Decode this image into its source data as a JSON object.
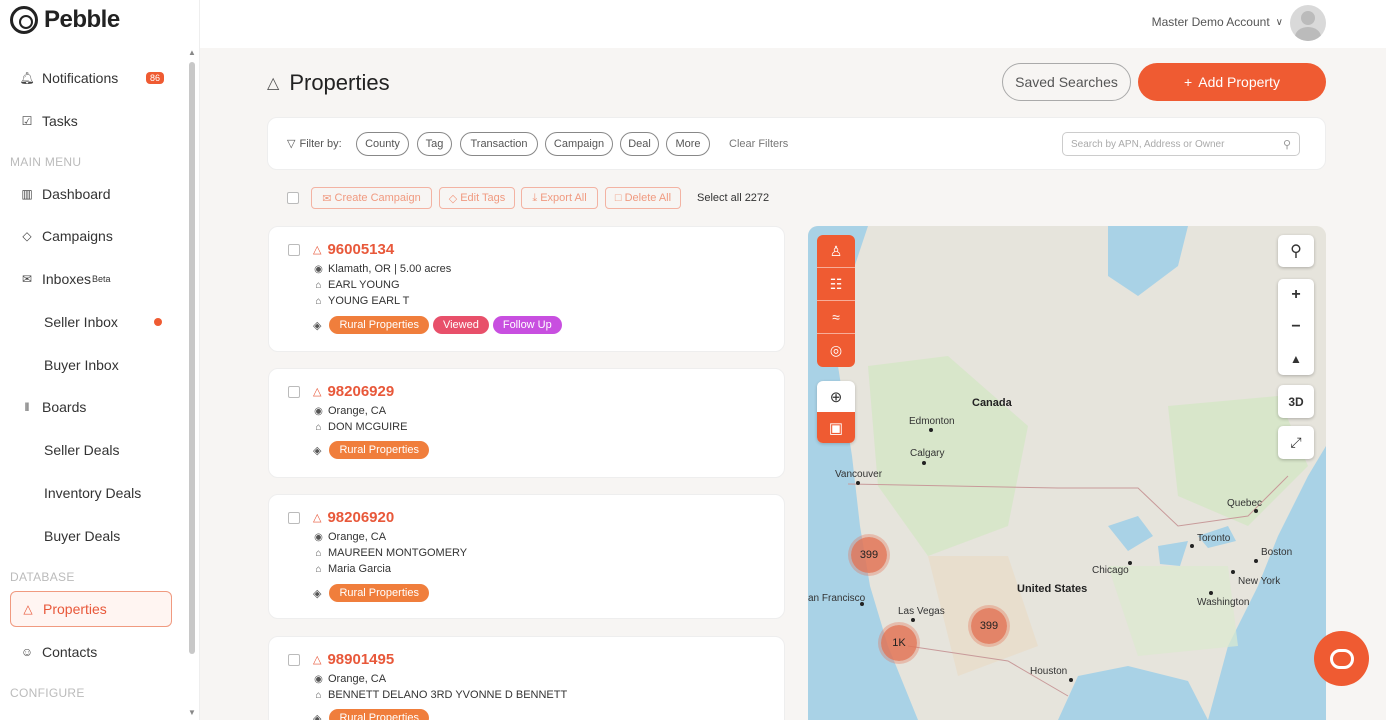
{
  "brand": {
    "name": "Pebble"
  },
  "sidebar": {
    "notifications": {
      "label": "Notifications",
      "count": "86"
    },
    "tasks": "Tasks",
    "main_menu_label": "MAIN MENU",
    "dashboard": "Dashboard",
    "campaigns": "Campaigns",
    "inboxes": {
      "label": "Inboxes",
      "badge": "Beta"
    },
    "seller_inbox": "Seller Inbox",
    "buyer_inbox": "Buyer Inbox",
    "boards": "Boards",
    "seller_deals": "Seller Deals",
    "inventory_deals": "Inventory Deals",
    "buyer_deals": "Buyer Deals",
    "database_label": "DATABASE",
    "properties": "Properties",
    "contacts": "Contacts",
    "configure_label": "CONFIGURE"
  },
  "topbar": {
    "account": "Master Demo Account"
  },
  "header": {
    "title": "Properties",
    "saved_searches": "Saved Searches",
    "add_property": "Add Property"
  },
  "filters": {
    "label": "Filter by:",
    "chips": [
      "County",
      "Tag",
      "Transaction",
      "Campaign",
      "Deal",
      "More"
    ],
    "clear": "Clear Filters",
    "search_placeholder": "Search by APN, Address or Owner"
  },
  "bulk": {
    "create_campaign": "Create Campaign",
    "edit_tags": "Edit Tags",
    "export_all": "Export All",
    "delete_all": "Delete All",
    "select_all": "Select all 2272"
  },
  "properties": [
    {
      "apn": "96005134",
      "location": "Klamath, OR | 5.00 acres",
      "owners": [
        "EARL YOUNG",
        "YOUNG EARL T"
      ],
      "tags": [
        "Rural Properties",
        "Viewed",
        "Follow Up"
      ]
    },
    {
      "apn": "98206929",
      "location": "Orange, CA",
      "owners": [
        "DON MCGUIRE"
      ],
      "tags": [
        "Rural Properties"
      ]
    },
    {
      "apn": "98206920",
      "location": "Orange, CA",
      "owners": [
        "MAUREEN MONTGOMERY",
        "Maria Garcia"
      ],
      "tags": [
        "Rural Properties"
      ]
    },
    {
      "apn": "98901495",
      "location": "Orange, CA",
      "owners": [
        "BENNETT DELANO 3RD YVONNE D BENNETT"
      ],
      "tags": [
        "Rural Properties"
      ]
    }
  ],
  "tag_colors": {
    "Rural Properties": "#f07e3c",
    "Viewed": "#e8506a",
    "Follow Up": "#c84fe0"
  },
  "map": {
    "labels": {
      "canada": "Canada",
      "united_states": "United States",
      "edmonton": "Edmonton",
      "calgary": "Calgary",
      "vancouver": "Vancouver",
      "quebec": "Quebec",
      "toronto": "Toronto",
      "boston": "Boston",
      "new_york": "New York",
      "washington": "Washington",
      "chicago": "Chicago",
      "las_vegas": "Las Vegas",
      "san_francisco": "an Francisco",
      "houston": "Houston"
    },
    "clusters": [
      "399",
      "1K",
      "399"
    ],
    "three_d": "3D"
  }
}
